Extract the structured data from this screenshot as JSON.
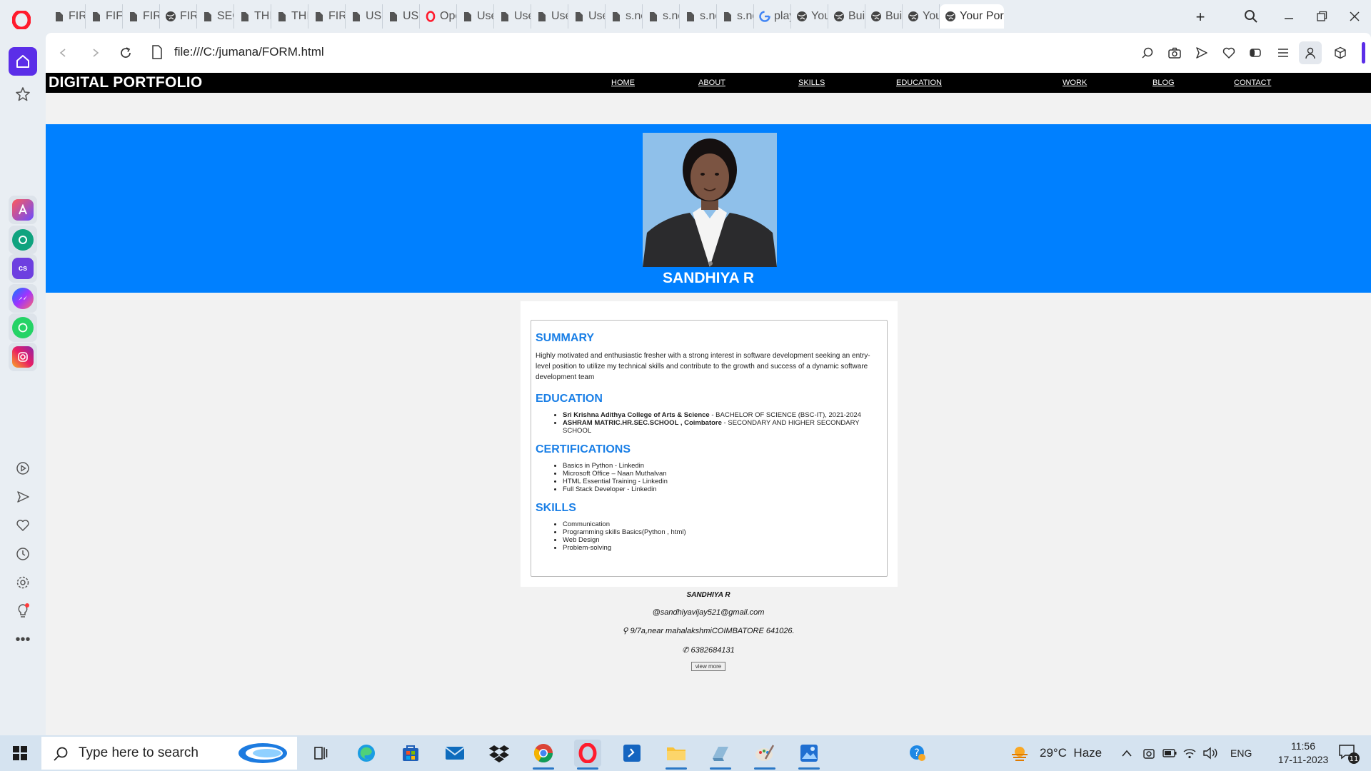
{
  "browser": {
    "tabs": [
      {
        "label": "FIRS",
        "icon": "document-icon"
      },
      {
        "label": "FIFT",
        "icon": "document-icon"
      },
      {
        "label": "FIRS",
        "icon": "document-icon"
      },
      {
        "label": "FIRS",
        "icon": "globe-icon"
      },
      {
        "label": "SEC",
        "icon": "document-icon"
      },
      {
        "label": "THI",
        "icon": "document-icon"
      },
      {
        "label": "THI",
        "icon": "document-icon"
      },
      {
        "label": "FIRS",
        "icon": "document-icon"
      },
      {
        "label": "USE",
        "icon": "document-icon"
      },
      {
        "label": "USE",
        "icon": "document-icon"
      },
      {
        "label": "Ope",
        "icon": "opera-icon"
      },
      {
        "label": "Use",
        "icon": "document-icon"
      },
      {
        "label": "Use",
        "icon": "document-icon"
      },
      {
        "label": "Use",
        "icon": "document-icon"
      },
      {
        "label": "Use",
        "icon": "document-icon"
      },
      {
        "label": "s.no",
        "icon": "document-icon"
      },
      {
        "label": "s.no",
        "icon": "document-icon"
      },
      {
        "label": "s.no",
        "icon": "document-icon"
      },
      {
        "label": "s.no",
        "icon": "document-icon"
      },
      {
        "label": "play",
        "icon": "google-icon"
      },
      {
        "label": "You",
        "icon": "globe-icon"
      },
      {
        "label": "Buil",
        "icon": "globe-icon"
      },
      {
        "label": "Buil",
        "icon": "globe-icon"
      },
      {
        "label": "You",
        "icon": "globe-icon"
      },
      {
        "label": "Your Por",
        "icon": "globe-icon",
        "active": true
      }
    ],
    "url": "file:///C:/jumana/FORM.html"
  },
  "site": {
    "brand": "DIGITAL PORTFOLIO",
    "nav": [
      "HOME",
      "ABOUT",
      "SKILLS",
      "EDUCATION",
      "WORK",
      "BLOG",
      "CONTACT"
    ],
    "name": "SANDHIYA R",
    "summary_title": "SUMMARY",
    "summary_text": "Highly motivated and enthusiastic fresher with a strong interest in software development seeking an entry-level position to utilize my technical skills and contribute to the growth and success of a dynamic software development team",
    "education_title": "EDUCATION",
    "education": [
      {
        "institution": "Sri Krishna Adithya College of Arts & Science",
        "detail": " - BACHELOR OF SCIENCE (BSC-IT), 2021-2024"
      },
      {
        "institution": "ASHRAM MATRIC.HR.SEC.SCHOOL , Coimbatore",
        "detail": " - SECONDARY AND HIGHER SECONDARY SCHOOL"
      }
    ],
    "certifications_title": "CERTIFICATIONS",
    "certifications": [
      "Basics in Python - Linkedin",
      "Microsoft Office – Naan Muthalvan",
      "HTML Essential Training - Linkedin",
      "Full Stack Developer - Linkedin"
    ],
    "skills_title": "SKILLS",
    "skills": [
      "Communication",
      "Programming skills Basics(Python , html)",
      "Web Design",
      "Problem-solving"
    ],
    "footer": {
      "name": "SANDHIYA R",
      "email": "@sandhiyavijay521@gmail.com",
      "address": "⚲ 9/7a,near mahalakshmiCOIMBATORE 641026.",
      "phone": "✆ 6382684131",
      "view_more": "view more"
    }
  },
  "taskbar": {
    "search_placeholder": "Type here to search",
    "weather": "29°C  Haze",
    "language": "ENG",
    "time": "11:56",
    "date": "17-11-2023",
    "notifications": "11"
  },
  "colors": {
    "hero_blue": "#0080ff",
    "section_blue": "#1a7fe6",
    "opera_red": "#ff1b2d"
  }
}
